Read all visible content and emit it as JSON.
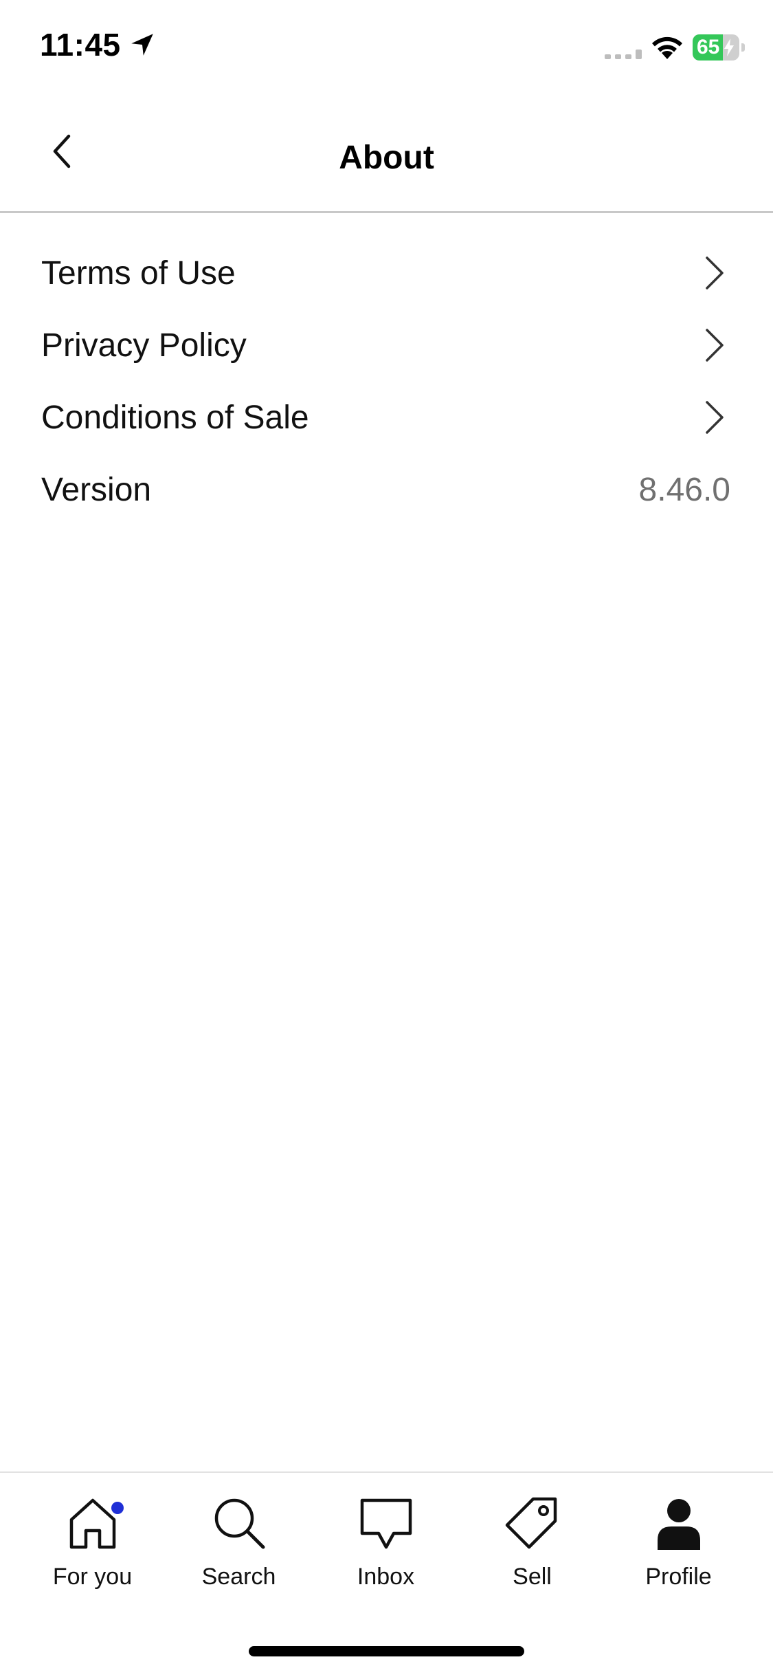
{
  "status_bar": {
    "time": "11:45",
    "battery_percent": 65,
    "battery_label": "65"
  },
  "nav": {
    "title": "About"
  },
  "rows": [
    {
      "label": "Terms of Use"
    },
    {
      "label": "Privacy Policy"
    },
    {
      "label": "Conditions of Sale"
    },
    {
      "label": "Version",
      "value": "8.46.0"
    }
  ],
  "tabs": [
    {
      "label": "For you",
      "icon": "home-icon"
    },
    {
      "label": "Search",
      "icon": "search-icon"
    },
    {
      "label": "Inbox",
      "icon": "message-icon"
    },
    {
      "label": "Sell",
      "icon": "tag-icon"
    },
    {
      "label": "Profile",
      "icon": "person-icon",
      "selected": true
    }
  ],
  "colors": {
    "notification_dot": "#1f2fd6",
    "battery_fill": "#34c759",
    "value_text": "#707070",
    "divider": "#c8c8c8"
  }
}
